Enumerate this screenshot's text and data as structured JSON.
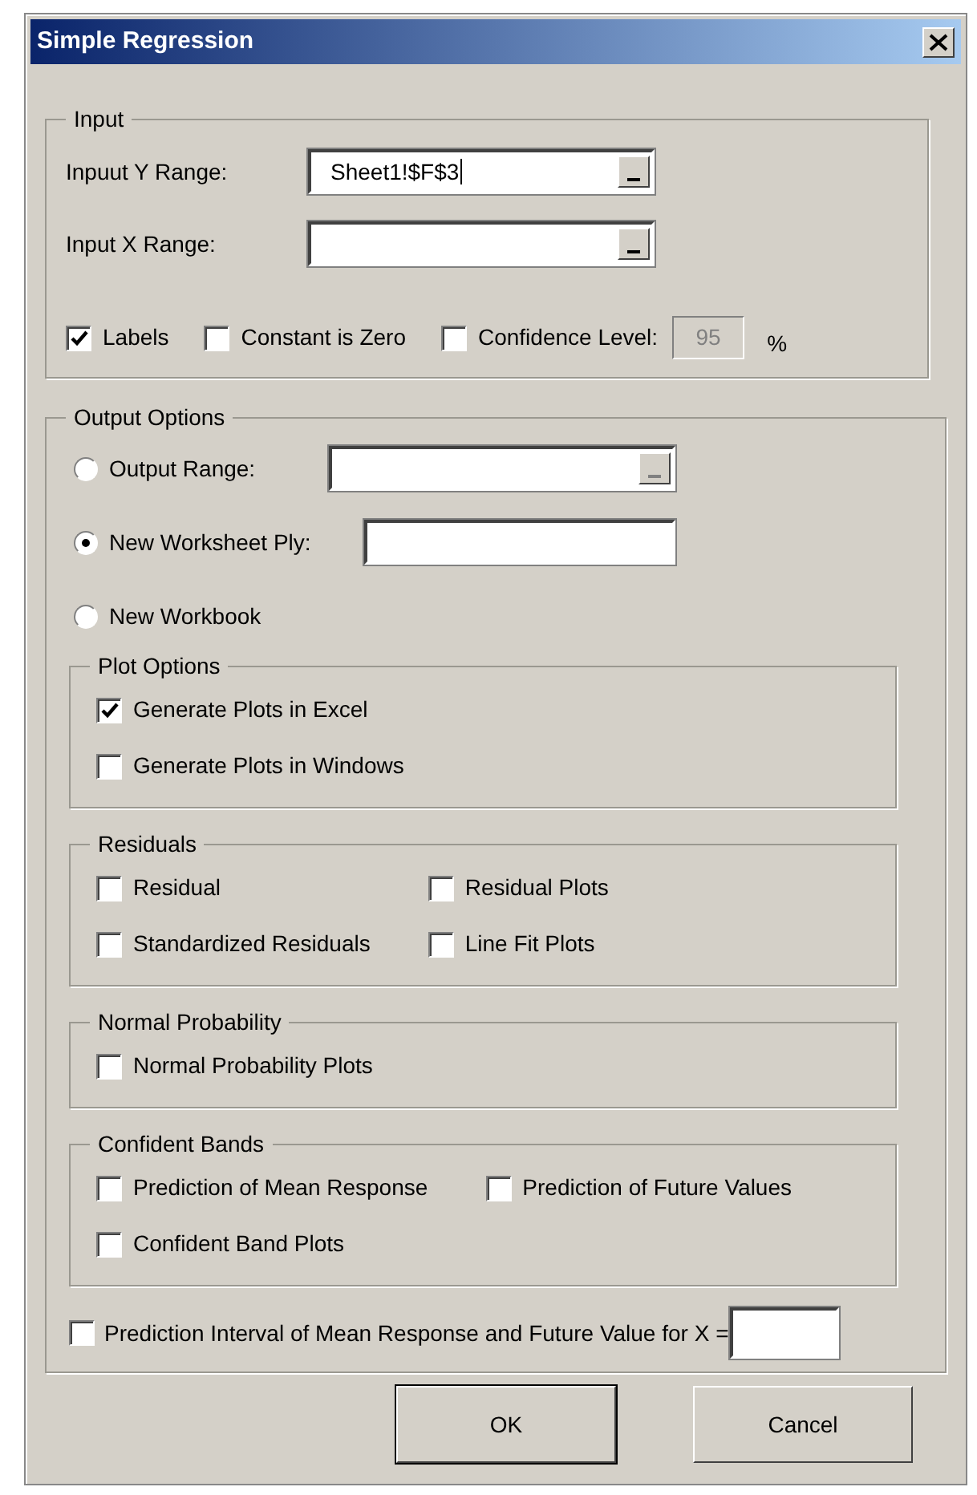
{
  "window": {
    "title": "Simple Regression"
  },
  "input": {
    "legend": "Input",
    "ranges": [
      {
        "label": "Inpuut Y Range:",
        "value": "Sheet1!$F$3",
        "caret": true
      },
      {
        "label": "Input X Range:",
        "caret": false
      }
    ],
    "options": [
      {
        "label": "Labels",
        "checked": true
      },
      {
        "label": "Constant is Zero",
        "checked": false
      },
      {
        "label": "Confidence Level:",
        "checked": false
      }
    ],
    "confidence": {
      "value": "95",
      "unit": "%",
      "disabled": true
    }
  },
  "output": {
    "legend": "Output Options",
    "choices": [
      {
        "label": "Output Range:",
        "selected": false,
        "kind": "range"
      },
      {
        "label": "New Worksheet Ply:",
        "selected": true,
        "kind": "text"
      },
      {
        "label": "New Workbook",
        "selected": false,
        "kind": "plain"
      }
    ],
    "groups": [
      {
        "legend": "Plot Options",
        "rows": [
          [
            {
              "label": "Generate Plots in Excel",
              "checked": true
            }
          ],
          [
            {
              "label": "Generate Plots in Windows",
              "checked": false
            }
          ]
        ]
      },
      {
        "legend": "Residuals",
        "rows": [
          [
            {
              "label": "Residual",
              "checked": false
            },
            {
              "label": "Residual Plots",
              "checked": false
            }
          ],
          [
            {
              "label": "Standardized Residuals",
              "checked": false
            },
            {
              "label": "Line Fit Plots",
              "checked": false
            }
          ]
        ]
      },
      {
        "legend": "Normal Probability",
        "rows": [
          [
            {
              "label": "Normal Probability Plots",
              "checked": false
            }
          ]
        ]
      },
      {
        "legend": "Confident Bands",
        "rows": [
          [
            {
              "label": "Prediction of Mean Response",
              "checked": false
            },
            {
              "label": "Prediction of Future Values",
              "checked": false
            }
          ],
          [
            {
              "label": "Confident Band Plots",
              "checked": false
            }
          ]
        ]
      }
    ],
    "interval": {
      "label": "Prediction Interval of Mean Response and Future Value for X =",
      "checked": false
    }
  },
  "buttons": [
    "OK",
    "Cancel"
  ]
}
